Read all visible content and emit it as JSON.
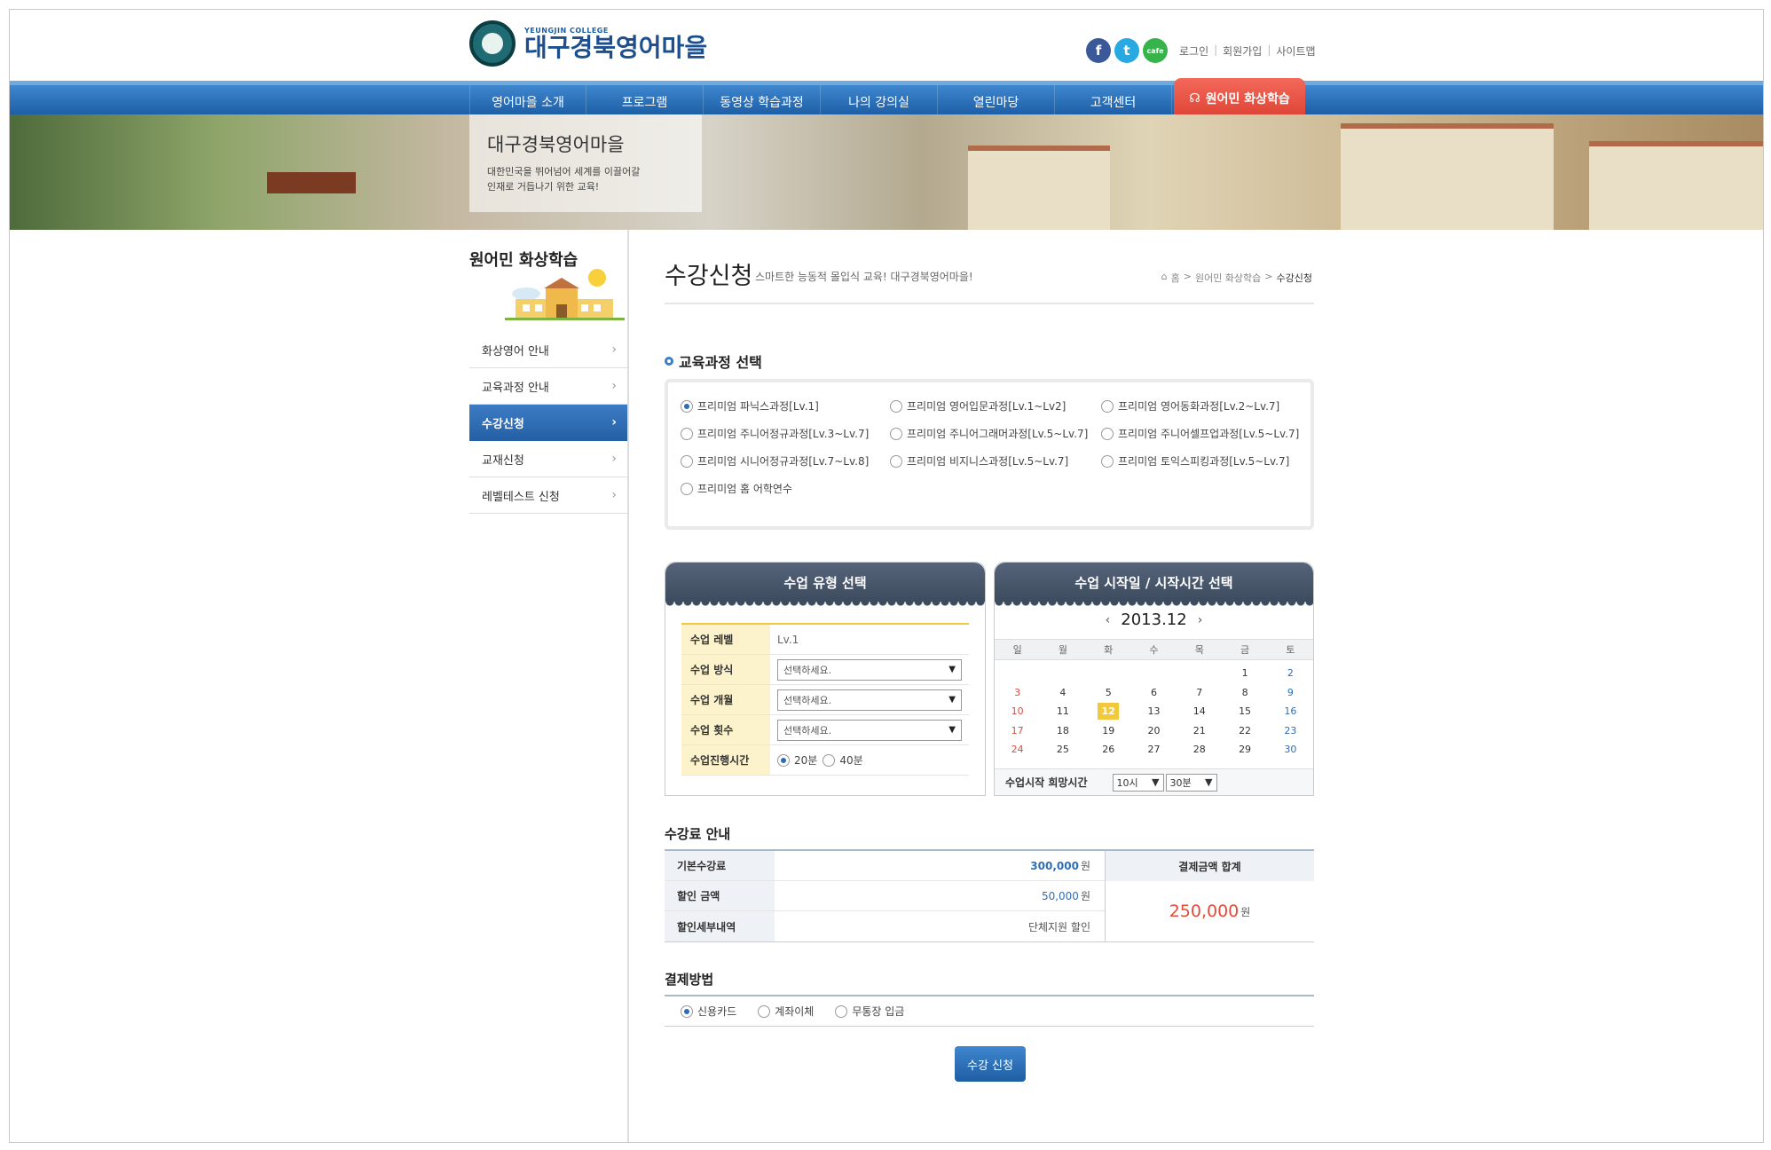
{
  "header": {
    "logo_sub": "YEUNGJIN COLLEGE",
    "logo_main": "대구경북영어마을",
    "social": [
      {
        "name": "facebook-icon",
        "glyph": "f",
        "color": "#3b5998"
      },
      {
        "name": "twitter-icon",
        "glyph": "t",
        "color": "#29a9e1"
      },
      {
        "name": "cafe-icon",
        "glyph": "cafe",
        "color": "#36b44a"
      }
    ],
    "links": [
      "로그인",
      "회원가입",
      "사이트맵"
    ]
  },
  "gnb": {
    "items": [
      "영어마을 소개",
      "프로그램",
      "동영상 학습과정",
      "나의 강의실",
      "열린마당",
      "고객센터"
    ],
    "special": "원어민 화상학습"
  },
  "hero": {
    "title": "대구경북영어마을",
    "text": "대한민국을 뛰어넘어 세계를 이끌어갈\n인재로 거듭나기 위한 교육!"
  },
  "sidebar": {
    "title": "원어민 화상학습",
    "items": [
      {
        "label": "화상영어 안내"
      },
      {
        "label": "교육과정 안내"
      },
      {
        "label": "수강신청"
      },
      {
        "label": "교재신청"
      },
      {
        "label": "레벨테스트 신청"
      }
    ]
  },
  "page": {
    "title": "수강신청",
    "subtitle": "스마트한 능동적 몰입식 교육! 대구경북영어마을!",
    "breadcrumb": [
      "홈",
      "원어민 화상학습",
      "수강신청"
    ]
  },
  "course": {
    "heading": "교육과정 선택",
    "options": [
      "프리미엄 파닉스과정[Lv.1]",
      "프리미엄 영어입문과정[Lv.1~Lv2]",
      "프리미엄 영어동화과정[Lv.2~Lv.7]",
      "프리미엄 주니어정규과정[Lv.3~Lv.7]",
      "프리미엄 주니어그래머과정[Lv.5~Lv.7]",
      "프리미엄 주니어셀프업과정[Lv.5~Lv.7]",
      "프리미엄 시니어정규과정[Lv.7~Lv.8]",
      "프리미엄 비지니스과정[Lv.5~Lv.7]",
      "프리미엄 토익스피킹과정[Lv.5~Lv.7]",
      "프리미엄 홈 어학연수"
    ],
    "selected_index": 0
  },
  "class_type": {
    "heading": "수업 유형 선택",
    "rows": {
      "level_label": "수업 레벨",
      "level_value": "Lv.1",
      "method_label": "수업 방식",
      "method_value": "선택하세요.",
      "months_label": "수업 개월",
      "months_value": "선택하세요.",
      "count_label": "수업 횟수",
      "count_value": "선택하세요.",
      "duration_label": "수업진행시간",
      "duration_options": [
        "20분",
        "40분"
      ],
      "duration_selected": 0
    }
  },
  "calendar": {
    "heading": "수업 시작일 / 시작시간 선택",
    "month": "2013.12",
    "weekdays": [
      "일",
      "월",
      "화",
      "수",
      "목",
      "금",
      "토"
    ],
    "first_weekday": 5,
    "days_in_month": 30,
    "selected_day": 12,
    "time_label": "수업시작 희망시간",
    "hour": "10시",
    "minute": "30분"
  },
  "fee": {
    "heading": "수강료 안내",
    "base_label": "기본수강료",
    "base_value": "300,000",
    "discount_label": "할인 금액",
    "discount_value": "50,000",
    "detail_label": "할인세부내역",
    "detail_value": "단체지원 할인",
    "currency": "원",
    "total_label": "결제금액 합계",
    "total_value": "250,000"
  },
  "payment": {
    "heading": "결제방법",
    "options": [
      "신용카드",
      "계좌이체",
      "무통장 입금"
    ],
    "selected_index": 0
  },
  "submit_label": "수강 신청"
}
